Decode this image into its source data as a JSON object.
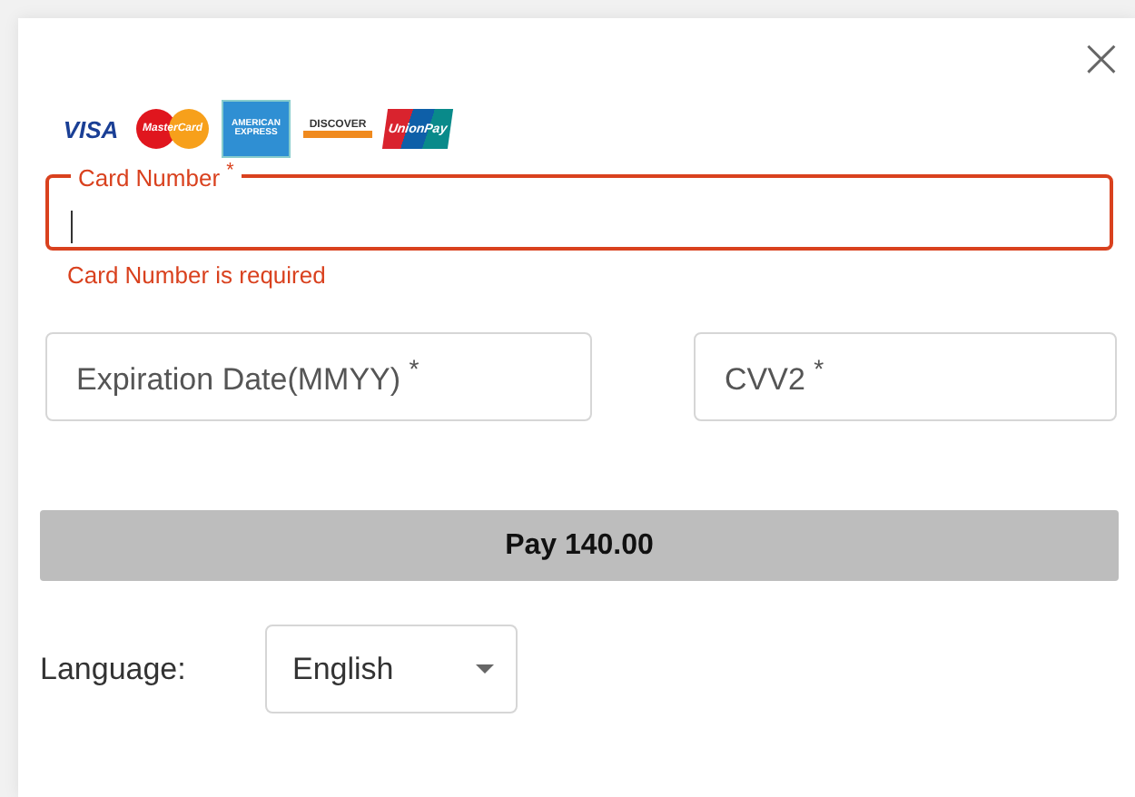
{
  "dialog": {
    "close": "×"
  },
  "card_logos": [
    {
      "kind": "visa",
      "label": "VISA"
    },
    {
      "kind": "mastercard",
      "label": "MasterCard"
    },
    {
      "kind": "amex",
      "label": "AMERICAN EXPRESS"
    },
    {
      "kind": "discover",
      "label": "DISCOVER"
    },
    {
      "kind": "unionpay",
      "label": "UnionPay"
    }
  ],
  "card_number": {
    "label": "Card Number $^{*}$",
    "focused": true,
    "error": true,
    "error_text": "Card Number is required"
  },
  "expiration": {
    "placeholder": "Expiration Date(MMYY) $^{*}$",
    "error": false
  },
  "cvv": {
    "placeholder": "CVV2 $^{*}$",
    "error": false
  },
  "pay_button": {
    "label": "Pay 140.00",
    "disabled": true
  },
  "language": {
    "label": "Language:",
    "value": "English"
  }
}
